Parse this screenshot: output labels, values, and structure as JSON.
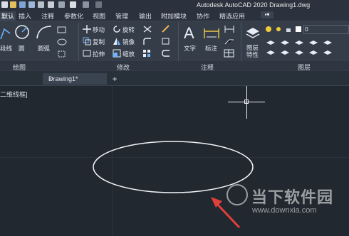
{
  "titlebar": {
    "title": "Autodesk AutoCAD 2020    Drawing1.dwg"
  },
  "menu": {
    "tabs": [
      {
        "label": "默认",
        "active": true
      },
      {
        "label": "插入"
      },
      {
        "label": "注释"
      },
      {
        "label": "参数化"
      },
      {
        "label": "视图"
      },
      {
        "label": "管理"
      },
      {
        "label": "输出"
      },
      {
        "label": "附加模块"
      },
      {
        "label": "协作"
      },
      {
        "label": "精选应用"
      }
    ]
  },
  "ribbon": {
    "draw": {
      "group_label": "绘图",
      "polyline_label": "段线",
      "circle_label": "圆",
      "arc_label": "圆弧"
    },
    "modify": {
      "group_label": "修改",
      "move_label": "移动",
      "rotate_label": "旋转",
      "copy_label": "复制",
      "mirror_label": "镜像",
      "stretch_label": "拉伸",
      "scale_label": "缩放"
    },
    "annotation": {
      "group_label": "注释",
      "text_label": "文字",
      "dimension_label": "标注"
    },
    "layers": {
      "group_label": "图层",
      "layer_properties_label": "图层特性",
      "layer_name": "0"
    }
  },
  "file_tabs": {
    "active_label": "Drawing1*",
    "close_glyph": "×",
    "add_glyph": "+"
  },
  "viewport": {
    "label": "二维线框]"
  },
  "watermark": {
    "text": "当下软件园",
    "url": "www.downxia.com"
  },
  "colors": {
    "background": "#212830",
    "ribbon": "#353d49",
    "ellipse": "#ffffff",
    "arrow": "#e0403a"
  }
}
